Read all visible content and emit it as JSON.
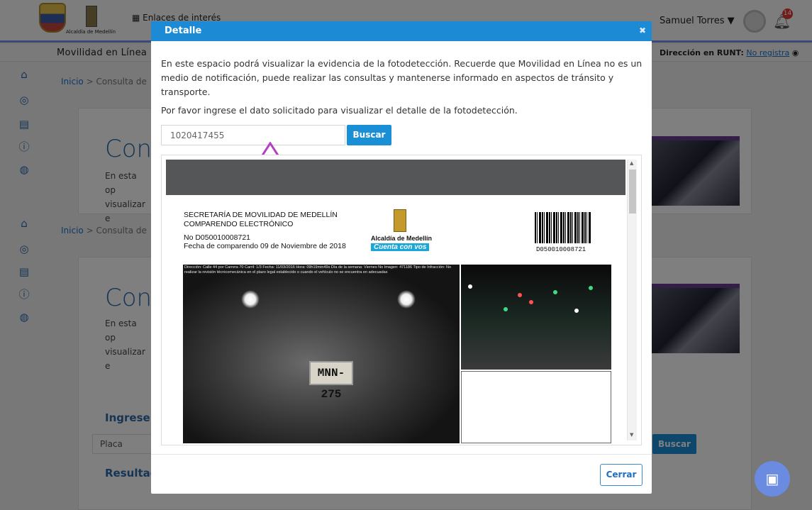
{
  "header": {
    "enlaces_label": "Enlaces de interés",
    "alcaldia_logo_text": "Alcaldía de Medellín",
    "user_name": "Samuel Torres",
    "notification_count": "14"
  },
  "subheader": {
    "app_title": "Movilidad en Línea",
    "runt_label": "Dirección en RUNT:",
    "runt_value": "No registra"
  },
  "background": {
    "breadcrumb_home": "Inicio",
    "breadcrumb_sep": ">",
    "breadcrumb_current": "Consulta de",
    "title_partial": "Con",
    "desc_partial": "En esta op visualizar e",
    "search_heading": "Ingrese l",
    "placa_placeholder": "Placa",
    "search_button": "Buscar",
    "results_heading": "Resultad"
  },
  "modal": {
    "title": "Detalle",
    "close_glyph": "✖",
    "intro_text": "En este espacio podrá visualizar la evidencia de la fotodetección. Recuerde que Movilidad en Línea no es un medio de notificación, puede realizar las consultas y mantenerse informado en aspectos de tránsito y transporte.",
    "instruction_text": "Por favor ingrese el dato solicitado para visualizar el detalle de la fotodetección.",
    "input_value": "1020417455",
    "search_button": "Buscar",
    "close_button": "Cerrar"
  },
  "document": {
    "secretaria": "SECRETARÍA DE MOVILIDAD DE MEDELLÍN",
    "comparendo": "COMPARENDO ELECTRÓNICO",
    "numero": "No D050010008721",
    "fecha": "Fecha de comparendo 09 de Noviembre de 2018",
    "logo_line1": "Alcaldía de Medellín",
    "logo_line2": "Cuenta con vos",
    "barcode_number": "D050010008721",
    "photo_caption": "Dirección: Calle 44 por Carrera 70  Carril: 1/3  Fecha: 11/03/2016 Hora: 09h19min49s  Día de la semana: Viernes  No Imagen: 471186  Tipo de Infracción: No realizar la revisión técnicomecánica en el plazo legal establecido o cuando el vehículo no se encuentra en adecuadas",
    "plate_text": "MNN-275"
  },
  "colors": {
    "primary": "#1d8ad6",
    "accent_arrow": "#b43fc4",
    "title_blue": "#2d6aa8"
  }
}
